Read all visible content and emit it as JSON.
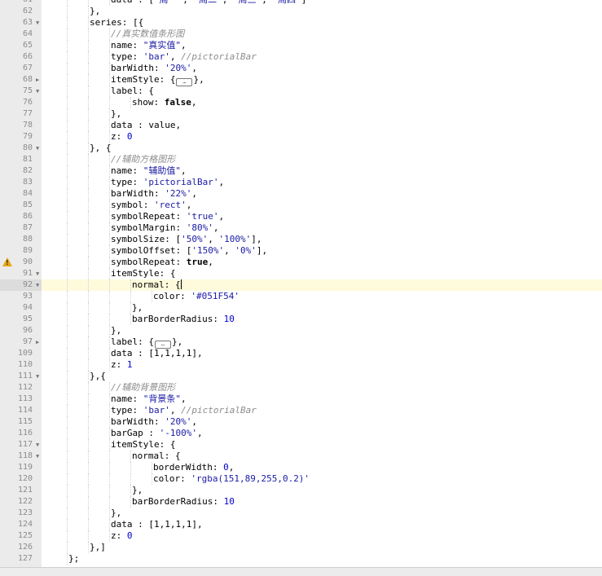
{
  "editor": {
    "active_line": 92,
    "warning_lines": [
      90
    ],
    "lines": [
      {
        "n": 61,
        "fold": false,
        "indent": 4,
        "tokens": [
          [
            "p",
            "data : ["
          ],
          [
            "s",
            "'周一'"
          ],
          [
            "p",
            ", "
          ],
          [
            "s",
            "'周二'"
          ],
          [
            "p",
            ", "
          ],
          [
            "s",
            "'周三'"
          ],
          [
            "p",
            ", "
          ],
          [
            "s",
            "'周四'"
          ],
          [
            "p",
            "]"
          ]
        ]
      },
      {
        "n": 62,
        "fold": false,
        "indent": 3,
        "tokens": [
          [
            "p",
            "},"
          ]
        ]
      },
      {
        "n": 63,
        "fold": true,
        "indent": 3,
        "tokens": [
          [
            "p",
            "series: [{"
          ]
        ]
      },
      {
        "n": 64,
        "fold": false,
        "indent": 4,
        "tokens": [
          [
            "c",
            "//真实数值条形图"
          ]
        ]
      },
      {
        "n": 65,
        "fold": false,
        "indent": 4,
        "tokens": [
          [
            "p",
            "name: "
          ],
          [
            "s",
            "\"真实值\""
          ],
          [
            "p",
            ","
          ]
        ]
      },
      {
        "n": 66,
        "fold": false,
        "indent": 4,
        "tokens": [
          [
            "p",
            "type: "
          ],
          [
            "s",
            "'bar'"
          ],
          [
            "p",
            ", "
          ],
          [
            "c",
            "//pictorialBar"
          ]
        ]
      },
      {
        "n": 67,
        "fold": false,
        "indent": 4,
        "tokens": [
          [
            "p",
            "barWidth: "
          ],
          [
            "s",
            "'20%'"
          ],
          [
            "p",
            ","
          ]
        ]
      },
      {
        "n": 68,
        "fold": true,
        "indent": 4,
        "tokens": [
          [
            "p",
            "itemStyle: {"
          ],
          [
            "f",
            "…"
          ],
          [
            "p",
            "},"
          ]
        ]
      },
      {
        "n": 75,
        "fold": true,
        "indent": 4,
        "tokens": [
          [
            "p",
            "label: {"
          ]
        ]
      },
      {
        "n": 76,
        "fold": false,
        "indent": 5,
        "tokens": [
          [
            "p",
            "show: "
          ],
          [
            "k",
            "false"
          ],
          [
            "p",
            ","
          ]
        ]
      },
      {
        "n": 77,
        "fold": false,
        "indent": 4,
        "tokens": [
          [
            "p",
            "},"
          ]
        ]
      },
      {
        "n": 78,
        "fold": false,
        "indent": 4,
        "tokens": [
          [
            "p",
            "data : value,"
          ]
        ]
      },
      {
        "n": 79,
        "fold": false,
        "indent": 4,
        "tokens": [
          [
            "p",
            "z: "
          ],
          [
            "n",
            "0"
          ]
        ]
      },
      {
        "n": 80,
        "fold": true,
        "indent": 3,
        "tokens": [
          [
            "p",
            "}, {"
          ]
        ]
      },
      {
        "n": 81,
        "fold": false,
        "indent": 4,
        "tokens": [
          [
            "c",
            "//辅助方格图形"
          ]
        ]
      },
      {
        "n": 82,
        "fold": false,
        "indent": 4,
        "tokens": [
          [
            "p",
            "name: "
          ],
          [
            "s",
            "\"辅助值\""
          ],
          [
            "p",
            ","
          ]
        ]
      },
      {
        "n": 83,
        "fold": false,
        "indent": 4,
        "tokens": [
          [
            "p",
            "type: "
          ],
          [
            "s",
            "'pictorialBar'"
          ],
          [
            "p",
            ","
          ]
        ]
      },
      {
        "n": 84,
        "fold": false,
        "indent": 4,
        "tokens": [
          [
            "p",
            "barWidth: "
          ],
          [
            "s",
            "'22%'"
          ],
          [
            "p",
            ","
          ]
        ]
      },
      {
        "n": 85,
        "fold": false,
        "indent": 4,
        "tokens": [
          [
            "p",
            "symbol: "
          ],
          [
            "s",
            "'rect'"
          ],
          [
            "p",
            ","
          ]
        ]
      },
      {
        "n": 86,
        "fold": false,
        "indent": 4,
        "tokens": [
          [
            "p",
            "symbolRepeat: "
          ],
          [
            "s",
            "'true'"
          ],
          [
            "p",
            ","
          ]
        ]
      },
      {
        "n": 87,
        "fold": false,
        "indent": 4,
        "tokens": [
          [
            "p",
            "symbolMargin: "
          ],
          [
            "s",
            "'80%'"
          ],
          [
            "p",
            ","
          ]
        ]
      },
      {
        "n": 88,
        "fold": false,
        "indent": 4,
        "tokens": [
          [
            "p",
            "symbolSize: ["
          ],
          [
            "s",
            "'50%'"
          ],
          [
            "p",
            ", "
          ],
          [
            "s",
            "'100%'"
          ],
          [
            "p",
            "],"
          ]
        ]
      },
      {
        "n": 89,
        "fold": false,
        "indent": 4,
        "tokens": [
          [
            "p",
            "symbolOffset: ["
          ],
          [
            "s",
            "'150%'"
          ],
          [
            "p",
            ", "
          ],
          [
            "s",
            "'0%'"
          ],
          [
            "p",
            "],"
          ]
        ]
      },
      {
        "n": 90,
        "fold": false,
        "indent": 4,
        "tokens": [
          [
            "p",
            "symbolRepeat: "
          ],
          [
            "k",
            "true"
          ],
          [
            "p",
            ","
          ]
        ]
      },
      {
        "n": 91,
        "fold": true,
        "indent": 4,
        "tokens": [
          [
            "p",
            "itemStyle: {"
          ]
        ]
      },
      {
        "n": 92,
        "fold": true,
        "indent": 5,
        "tokens": [
          [
            "p",
            "normal: {"
          ],
          [
            "cur",
            ""
          ]
        ]
      },
      {
        "n": 93,
        "fold": false,
        "indent": 6,
        "tokens": [
          [
            "p",
            "color: "
          ],
          [
            "s",
            "'#051F54'"
          ]
        ]
      },
      {
        "n": 94,
        "fold": false,
        "indent": 5,
        "tokens": [
          [
            "p",
            "},"
          ]
        ]
      },
      {
        "n": 95,
        "fold": false,
        "indent": 5,
        "tokens": [
          [
            "p",
            "barBorderRadius: "
          ],
          [
            "n",
            "10"
          ]
        ]
      },
      {
        "n": 96,
        "fold": false,
        "indent": 4,
        "tokens": [
          [
            "p",
            "},"
          ]
        ]
      },
      {
        "n": 97,
        "fold": true,
        "indent": 4,
        "tokens": [
          [
            "p",
            "label: {"
          ],
          [
            "f",
            "…"
          ],
          [
            "p",
            "},"
          ]
        ]
      },
      {
        "n": 109,
        "fold": false,
        "indent": 4,
        "tokens": [
          [
            "p",
            "data : [1,1,1,1],"
          ]
        ]
      },
      {
        "n": 110,
        "fold": false,
        "indent": 4,
        "tokens": [
          [
            "p",
            "z: "
          ],
          [
            "n",
            "1"
          ]
        ]
      },
      {
        "n": 111,
        "fold": true,
        "indent": 3,
        "tokens": [
          [
            "p",
            "},{"
          ]
        ]
      },
      {
        "n": 112,
        "fold": false,
        "indent": 4,
        "tokens": [
          [
            "c",
            "//辅助背景图形"
          ]
        ]
      },
      {
        "n": 113,
        "fold": false,
        "indent": 4,
        "tokens": [
          [
            "p",
            "name: "
          ],
          [
            "s",
            "\"背景条\""
          ],
          [
            "p",
            ","
          ]
        ]
      },
      {
        "n": 114,
        "fold": false,
        "indent": 4,
        "tokens": [
          [
            "p",
            "type: "
          ],
          [
            "s",
            "'bar'"
          ],
          [
            "p",
            ", "
          ],
          [
            "c",
            "//pictorialBar"
          ]
        ]
      },
      {
        "n": 115,
        "fold": false,
        "indent": 4,
        "tokens": [
          [
            "p",
            "barWidth: "
          ],
          [
            "s",
            "'20%'"
          ],
          [
            "p",
            ","
          ]
        ]
      },
      {
        "n": 116,
        "fold": false,
        "indent": 4,
        "tokens": [
          [
            "p",
            "barGap : "
          ],
          [
            "s",
            "'-100%'"
          ],
          [
            "p",
            ","
          ]
        ]
      },
      {
        "n": 117,
        "fold": true,
        "indent": 4,
        "tokens": [
          [
            "p",
            "itemStyle: {"
          ]
        ]
      },
      {
        "n": 118,
        "fold": true,
        "indent": 5,
        "tokens": [
          [
            "p",
            "normal: {"
          ]
        ]
      },
      {
        "n": 119,
        "fold": false,
        "indent": 6,
        "tokens": [
          [
            "p",
            "borderWidth: "
          ],
          [
            "n",
            "0"
          ],
          [
            "p",
            ","
          ]
        ]
      },
      {
        "n": 120,
        "fold": false,
        "indent": 6,
        "tokens": [
          [
            "p",
            "color: "
          ],
          [
            "s",
            "'rgba(151,89,255,0.2)'"
          ]
        ]
      },
      {
        "n": 121,
        "fold": false,
        "indent": 5,
        "tokens": [
          [
            "p",
            "},"
          ]
        ]
      },
      {
        "n": 122,
        "fold": false,
        "indent": 5,
        "tokens": [
          [
            "p",
            "barBorderRadius: "
          ],
          [
            "n",
            "10"
          ]
        ]
      },
      {
        "n": 123,
        "fold": false,
        "indent": 4,
        "tokens": [
          [
            "p",
            "},"
          ]
        ]
      },
      {
        "n": 124,
        "fold": false,
        "indent": 4,
        "tokens": [
          [
            "p",
            "data : [1,1,1,1],"
          ]
        ]
      },
      {
        "n": 125,
        "fold": false,
        "indent": 4,
        "tokens": [
          [
            "p",
            "z: "
          ],
          [
            "n",
            "0"
          ]
        ]
      },
      {
        "n": 126,
        "fold": false,
        "indent": 3,
        "tokens": [
          [
            "p",
            "},]"
          ]
        ]
      },
      {
        "n": 127,
        "fold": false,
        "indent": 2,
        "tokens": [
          [
            "p",
            "};"
          ]
        ]
      }
    ]
  },
  "statusbar": {
    "left_text": "",
    "right_text": ""
  },
  "colors": {
    "string": "#1a1aa6",
    "number": "#0000cd",
    "comment": "#8c8c8c",
    "keyword": "#000000",
    "active_line_bg": "#fdfbdc",
    "gutter_bg": "#ebebeb",
    "warning": "#e6a817"
  },
  "icons": {
    "fold_open": "fold-arrow-down-icon",
    "fold_closed": "fold-arrow-right-icon",
    "warning": "warning-icon"
  }
}
